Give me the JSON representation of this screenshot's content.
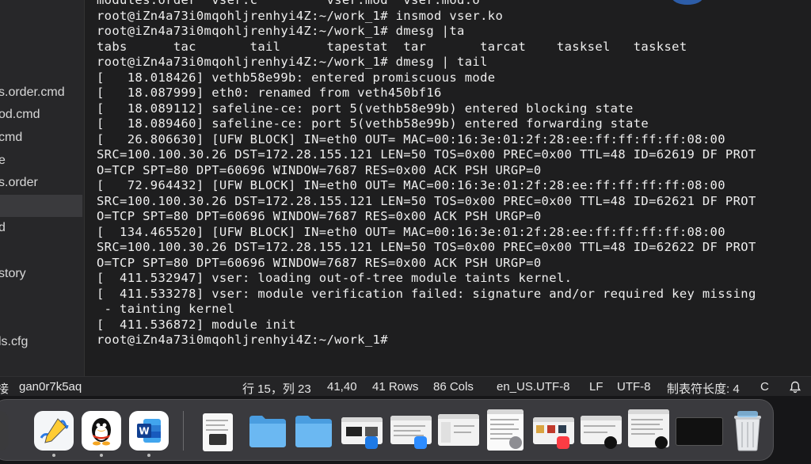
{
  "sidebar": {
    "items": [
      {
        "label": "s.order.cmd"
      },
      {
        "label": "od.cmd"
      },
      {
        "label": "cmd"
      },
      {
        "label": "e"
      },
      {
        "label": "s.order"
      },
      {
        "label": ""
      },
      {
        "label": "d"
      },
      {
        "label": ""
      },
      {
        "label": "story"
      },
      {
        "label": ""
      },
      {
        "label": "ls.cfg"
      }
    ],
    "selected_index": 5
  },
  "terminal": {
    "lines": [
      "modules.order  vser.c         vser.mod  vser.mod.o",
      "root@iZn4a73i0mqohljrenhyi4Z:~/work_1# insmod vser.ko",
      "root@iZn4a73i0mqohljrenhyi4Z:~/work_1# dmesg |ta",
      "tabs      tac       tail      tapestat  tar       tarcat    tasksel   taskset",
      "root@iZn4a73i0mqohljrenhyi4Z:~/work_1# dmesg | tail",
      "[   18.018426] vethb58e99b: entered promiscuous mode",
      "[   18.087999] eth0: renamed from veth450bf16",
      "[   18.089112] safeline-ce: port 5(vethb58e99b) entered blocking state",
      "[   18.089460] safeline-ce: port 5(vethb58e99b) entered forwarding state",
      "[   26.806630] [UFW BLOCK] IN=eth0 OUT= MAC=00:16:3e:01:2f:28:ee:ff:ff:ff:ff:08:00",
      "SRC=100.100.30.26 DST=172.28.155.121 LEN=50 TOS=0x00 PREC=0x00 TTL=48 ID=62619 DF PROT",
      "O=TCP SPT=80 DPT=60696 WINDOW=7687 RES=0x00 ACK PSH URGP=0",
      "[   72.964432] [UFW BLOCK] IN=eth0 OUT= MAC=00:16:3e:01:2f:28:ee:ff:ff:ff:ff:08:00",
      "SRC=100.100.30.26 DST=172.28.155.121 LEN=50 TOS=0x00 PREC=0x00 TTL=48 ID=62621 DF PROT",
      "O=TCP SPT=80 DPT=60696 WINDOW=7687 RES=0x00 ACK PSH URGP=0",
      "[  134.465520] [UFW BLOCK] IN=eth0 OUT= MAC=00:16:3e:01:2f:28:ee:ff:ff:ff:ff:08:00",
      "SRC=100.100.30.26 DST=172.28.155.121 LEN=50 TOS=0x00 PREC=0x00 TTL=48 ID=62622 DF PROT",
      "O=TCP SPT=80 DPT=60696 WINDOW=7687 RES=0x00 ACK PSH URGP=0",
      "[  411.532947] vser: loading out-of-tree module taints kernel.",
      "[  411.533278] vser: module verification failed: signature and/or required key missing",
      " - tainting kernel",
      "[  411.536872] module init",
      "root@iZn4a73i0mqohljrenhyi4Z:~/work_1#"
    ]
  },
  "statusbar": {
    "connection": "接",
    "session": "gan0r7k5aq",
    "position": "行 15，列 23",
    "cursor": "41,40",
    "rows": "41 Rows",
    "cols": "86 Cols",
    "encoding_locale": "en_US.UTF-8",
    "line_ending": "LF",
    "charset": "UTF-8",
    "tab_width": "制表符长度: 4",
    "language": "C"
  },
  "icons": {
    "bell": "bell-icon"
  },
  "dock": {
    "apps": [
      {
        "name": "freeform-icon",
        "color": "#f4f6f8",
        "running": true
      },
      {
        "name": "qq-icon",
        "color": "#ffffff",
        "running": true
      },
      {
        "name": "word-icon",
        "color": "#ffffff",
        "running": true
      }
    ],
    "windows": [
      {
        "name": "window-thumb-document",
        "color": "#f4f4f4"
      },
      {
        "name": "folder-icon",
        "color": "#5fb0ee"
      },
      {
        "name": "folder-icon-2",
        "color": "#5fb0ee"
      },
      {
        "name": "window-thumb-windows",
        "color": "#f0f0f0"
      },
      {
        "name": "window-thumb-zoom",
        "color": "#f0f0f0"
      },
      {
        "name": "window-thumb-settings",
        "color": "#f0f0f0"
      },
      {
        "name": "window-thumb-list",
        "color": "#f5f5f5"
      },
      {
        "name": "window-thumb-music",
        "color": "#f5f5f5"
      },
      {
        "name": "window-thumb-qq",
        "color": "#f5f5f5"
      },
      {
        "name": "window-thumb-qq-2",
        "color": "#eeeeee"
      },
      {
        "name": "window-thumb-terminal",
        "color": "#1b1b1b"
      },
      {
        "name": "trash-icon",
        "color": "#e8e8ea"
      }
    ]
  }
}
